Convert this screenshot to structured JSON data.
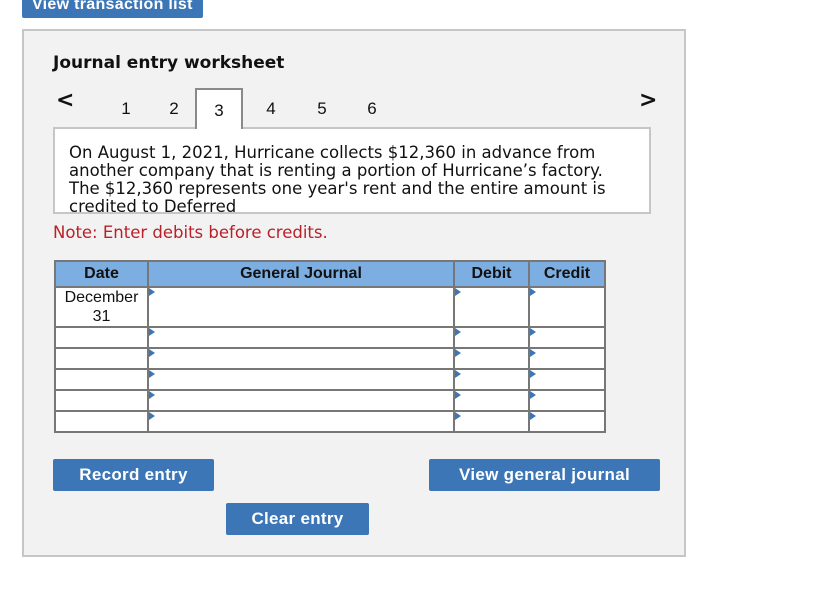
{
  "top_button": {
    "label": "View transaction list"
  },
  "worksheet": {
    "title": "Journal entry worksheet",
    "nav": {
      "prev_icon": "chevron-left-icon",
      "next_icon": "chevron-right-icon",
      "prev_glyph": "<",
      "next_glyph": ">"
    },
    "tabs": [
      {
        "label": "1",
        "active": false
      },
      {
        "label": "2",
        "active": false
      },
      {
        "label": "3",
        "active": true
      },
      {
        "label": "4",
        "active": false
      },
      {
        "label": "5",
        "active": false
      },
      {
        "label": "6",
        "active": false
      }
    ],
    "question": "On August 1, 2021, Hurricane collects $12,360 in advance from another company that is renting a portion of Hurricane’s factory. The $12,360 represents one year's rent and the entire amount is credited to Deferred",
    "note": "Note: Enter debits before credits.",
    "table": {
      "headers": {
        "date": "Date",
        "general_journal": "General Journal",
        "debit": "Debit",
        "credit": "Credit"
      },
      "rows": [
        {
          "date": "December 31",
          "account": "",
          "debit": "",
          "credit": ""
        },
        {
          "date": "",
          "account": "",
          "debit": "",
          "credit": ""
        },
        {
          "date": "",
          "account": "",
          "debit": "",
          "credit": ""
        },
        {
          "date": "",
          "account": "",
          "debit": "",
          "credit": ""
        },
        {
          "date": "",
          "account": "",
          "debit": "",
          "credit": ""
        },
        {
          "date": "",
          "account": "",
          "debit": "",
          "credit": ""
        }
      ]
    },
    "buttons": {
      "record": "Record entry",
      "clear": "Clear entry",
      "view_journal": "View general journal"
    }
  }
}
